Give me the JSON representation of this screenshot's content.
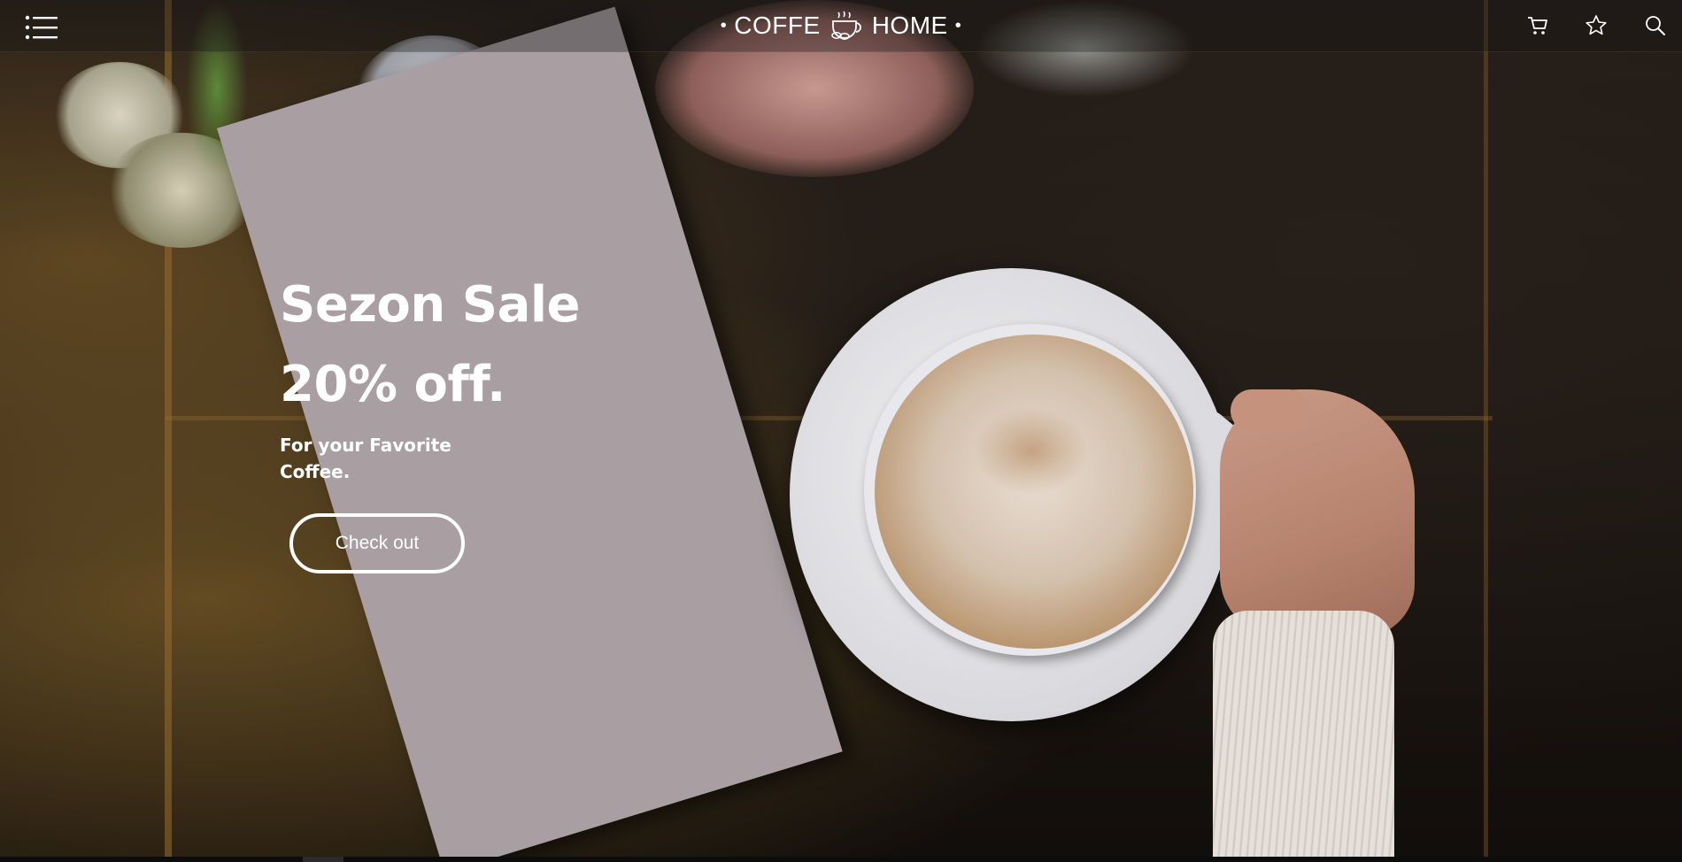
{
  "header": {
    "brand_left": "COFFE",
    "brand_right": "HOME",
    "brand_separator": "•",
    "icons": {
      "menu": "hamburger-menu-icon",
      "logo": "coffee-cup-icon",
      "cart": "cart-icon",
      "favorites": "star-icon",
      "search": "search-icon"
    }
  },
  "hero": {
    "title_line1": "Sezon Sale",
    "title_line2": "20% off.",
    "subtitle": "For your Favorite Coffee.",
    "cta_label": "Check out"
  },
  "colors": {
    "menu_card": "#a99ea1",
    "text": "#ffffff",
    "background": "#1d1713"
  }
}
